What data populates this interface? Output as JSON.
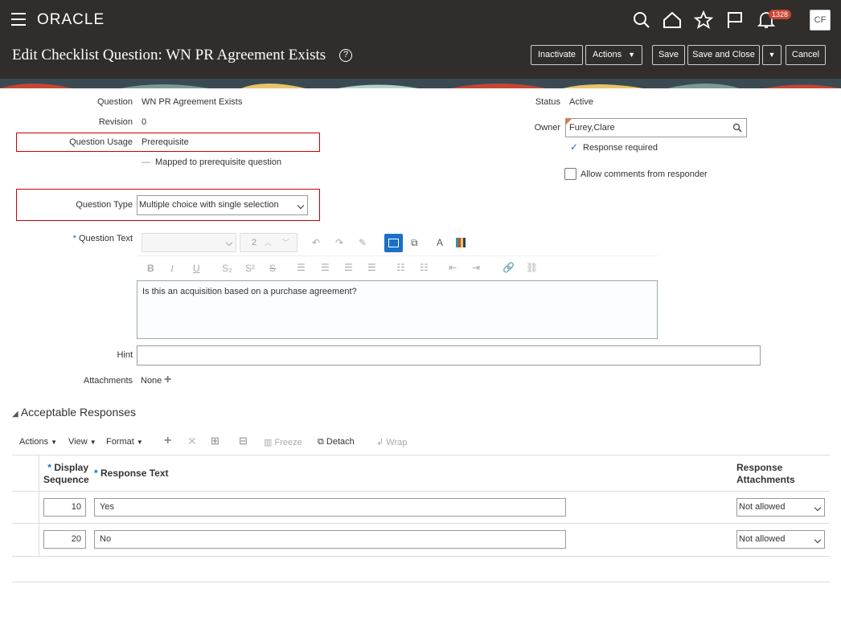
{
  "topbar": {
    "logo": "ORACLE",
    "notifications_count": "1328",
    "user_initials": "CF",
    "icons": [
      "search-icon",
      "home-icon",
      "star-icon",
      "flag-icon",
      "bell-icon"
    ]
  },
  "header": {
    "title": "Edit Checklist Question: WN PR Agreement Exists",
    "buttons": {
      "inactivate": "Inactivate",
      "actions": "Actions",
      "save": "Save",
      "save_close": "Save and Close",
      "cancel": "Cancel"
    }
  },
  "form": {
    "question_label": "Question",
    "question_value": "WN PR Agreement Exists",
    "revision_label": "Revision",
    "revision_value": "0",
    "usage_label": "Question Usage",
    "usage_value": "Prerequisite",
    "mapped_text": "Mapped to prerequisite question",
    "type_label": "Question Type",
    "type_value": "Multiple choice with single selection",
    "qtext_label": "Question Text",
    "font_size": "2",
    "qtext_value": "Is this an acquisition based on a purchase agreement?",
    "hint_label": "Hint",
    "attachments_label": "Attachments",
    "attachments_value": "None",
    "status_label": "Status",
    "status_value": "Active",
    "owner_label": "Owner",
    "owner_value": "Furey,Clare",
    "response_required": "Response required",
    "allow_comments": "Allow comments from responder"
  },
  "responses": {
    "section_title": "Acceptable Responses",
    "toolbar": {
      "actions": "Actions",
      "view": "View",
      "format": "Format",
      "freeze": "Freeze",
      "detach": "Detach",
      "wrap": "Wrap"
    },
    "columns": {
      "display_seq_1": "Display",
      "display_seq_2": "Sequence",
      "response_text": "Response Text",
      "attachments_1": "Response",
      "attachments_2": "Attachments"
    },
    "rows": [
      {
        "seq": "10",
        "text": "Yes",
        "attach": "Not allowed"
      },
      {
        "seq": "20",
        "text": "No",
        "attach": "Not allowed"
      }
    ]
  }
}
